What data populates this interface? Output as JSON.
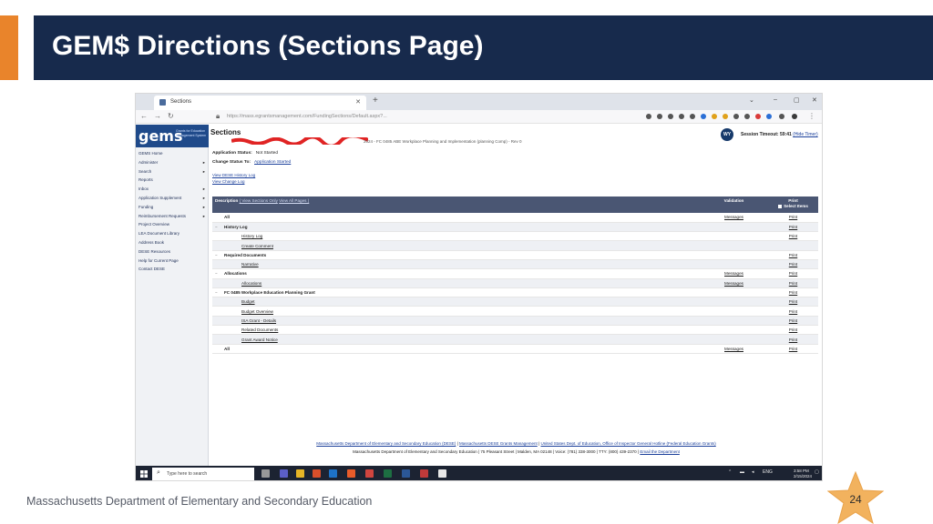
{
  "slide": {
    "title": "GEM$ Directions (Sections Page)",
    "footer": "Massachusetts Department of Elementary and Secondary Education",
    "page_number": "24",
    "colors": {
      "accent": "#e9842b",
      "title_band": "#172a4c",
      "star": "#f2b25e"
    }
  },
  "browser": {
    "tab_title": "Sections",
    "url": "https://mass.egrantsmanagement.com/FundingSections/Default.aspx?...",
    "window_controls": [
      "‒",
      "▢",
      "✕"
    ]
  },
  "app": {
    "logo_text": "gems",
    "logo_sub": "Grants for Education Management System",
    "page_heading": "Sections",
    "application_label": "2024 - FC 0485 ABE Workplace Planning and Implementation (planning Comp) - Rev 0",
    "user_initials": "WY",
    "session_timeout_label": "Session Timeout: 59:41",
    "hide_timer": "(Hide Timer)"
  },
  "sidebar": {
    "items": [
      {
        "label": "GEMS Home",
        "caret": ""
      },
      {
        "label": "Administer",
        "caret": "▸"
      },
      {
        "label": "Search",
        "caret": "▸"
      },
      {
        "label": "Reports",
        "caret": ""
      },
      {
        "label": "Inbox",
        "caret": "▸"
      },
      {
        "label": "Application Supplement",
        "caret": "▸"
      },
      {
        "label": "Funding",
        "caret": "▸"
      },
      {
        "label": "Reimbursement Requests",
        "caret": "▸"
      },
      {
        "label": "Project Overview",
        "caret": ""
      },
      {
        "label": "LEA Document Library",
        "caret": ""
      },
      {
        "label": "Address Book",
        "caret": ""
      },
      {
        "label": "DESE Resources",
        "caret": ""
      },
      {
        "label": "Help for Current Page",
        "caret": ""
      },
      {
        "label": "Contact DESE",
        "caret": ""
      }
    ]
  },
  "status": {
    "application_status_label": "Application Status:",
    "application_status_value": "Not Started",
    "change_status_label": "Change Status To:",
    "change_status_value": "Application Started",
    "history_link": "View DESE History Log",
    "change_log_link": "View Change Log"
  },
  "table": {
    "headers": {
      "description": "Description",
      "view_sections_only": "( View Sections Only",
      "view_all_pages": "View All Pages )",
      "validation": "Validation",
      "print": "Print",
      "select_items": "Select Items"
    },
    "rows": [
      {
        "dash": "",
        "label": "All",
        "type": "bold",
        "validation": "Messages",
        "print": "Print"
      },
      {
        "dash": "−",
        "label": "History Log",
        "type": "bold",
        "validation": "",
        "print": "Print"
      },
      {
        "dash": "",
        "label": "History Log",
        "type": "child",
        "validation": "",
        "print": "Print"
      },
      {
        "dash": "",
        "label": "Create Comment",
        "type": "child",
        "validation": "",
        "print": ""
      },
      {
        "dash": "−",
        "label": "Required Documents",
        "type": "bold",
        "validation": "",
        "print": "Print"
      },
      {
        "dash": "",
        "label": "Narrative",
        "type": "child",
        "validation": "",
        "print": "Print"
      },
      {
        "dash": "−",
        "label": "Allocations",
        "type": "bold",
        "validation": "Messages",
        "print": "Print"
      },
      {
        "dash": "",
        "label": "Allocations",
        "type": "child",
        "validation": "Messages",
        "print": "Print"
      },
      {
        "dash": "−",
        "label": "FC 0485 Workplace Education Planning Grant",
        "type": "bold",
        "validation": "",
        "print": "Print"
      },
      {
        "dash": "",
        "label": "Budget",
        "type": "child",
        "validation": "",
        "print": "Print"
      },
      {
        "dash": "",
        "label": "Budget Overview",
        "type": "child",
        "validation": "",
        "print": "Print"
      },
      {
        "dash": "",
        "label": "ISA Grant - Details",
        "type": "child",
        "validation": "",
        "print": "Print"
      },
      {
        "dash": "",
        "label": "Related Documents",
        "type": "child",
        "validation": "",
        "print": "Print"
      },
      {
        "dash": "",
        "label": "Grant Award Notice",
        "type": "child",
        "validation": "",
        "print": "Print"
      },
      {
        "dash": "",
        "label": "All",
        "type": "bold",
        "validation": "Messages",
        "print": "Print"
      }
    ]
  },
  "page_footer": {
    "line1_links": [
      "Massachusetts Department of Elementary and Secondary Education (DESE)",
      "Massachusetts DESE Grants Management",
      "United States Dept. of Education, Office of Inspector General Hotline (Federal Education Grants)"
    ],
    "line2": "Massachusetts Department of Elementary and Secondary Education  |  75 Pleasant Street  |  Malden, MA 02148  |  Voice: (781) 338-3000  |  TTY: (800) 439-2370  |",
    "line2_link": "Email the Department"
  },
  "taskbar": {
    "search_placeholder": "Type here to search",
    "language": "ENG",
    "time": "3:58 PM",
    "date": "2/15/2024"
  }
}
